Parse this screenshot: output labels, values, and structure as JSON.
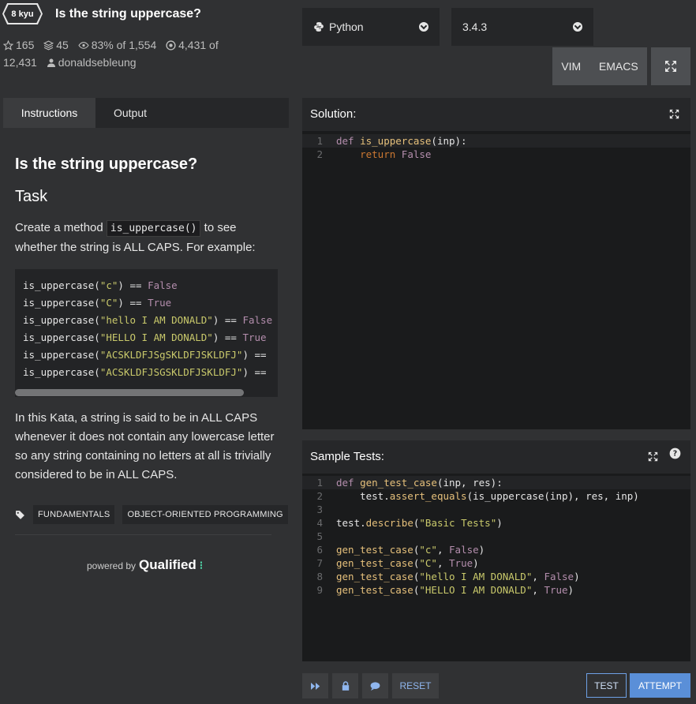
{
  "header": {
    "rank": "8 kyu",
    "title": "Is the string uppercase?",
    "stats": {
      "stars": "165",
      "collections": "45",
      "satisfaction": "83% of 1,554",
      "completed": "4,431 of",
      "total": "12,431",
      "author": "donaldsebleung"
    },
    "language": "Python",
    "version": "3.4.3",
    "mode_vim": "VIM",
    "mode_emacs": "EMACS"
  },
  "tabs": {
    "instructions": "Instructions",
    "output": "Output"
  },
  "instructions": {
    "title": "Is the string uppercase?",
    "task_heading": "Task",
    "intro_before": "Create a method",
    "intro_code": "is_uppercase()",
    "intro_after": "to see whether the string is ALL CAPS. For example:",
    "code_examples": [
      {
        "fn": "is_uppercase(",
        "arg": "\"c\"",
        "rest": ") == ",
        "result": "False"
      },
      {
        "fn": "is_uppercase(",
        "arg": "\"C\"",
        "rest": ") == ",
        "result": "True"
      },
      {
        "fn": "is_uppercase(",
        "arg": "\"hello I AM DONALD\"",
        "rest": ") == ",
        "result": "False"
      },
      {
        "fn": "is_uppercase(",
        "arg": "\"HELLO I AM DONALD\"",
        "rest": ") == ",
        "result": "True"
      },
      {
        "fn": "is_uppercase(",
        "arg": "\"ACSKLDFJSgSKLDFJSKLDFJ\"",
        "rest": ") ==",
        "result": ""
      },
      {
        "fn": "is_uppercase(",
        "arg": "\"ACSKLDFJSGSKLDFJSKLDFJ\"",
        "rest": ") ==",
        "result": ""
      }
    ],
    "explanation": "In this Kata, a string is said to be in ALL CAPS whenever it does not contain any lowercase letter so any string containing no letters at all is trivially considered to be in ALL CAPS.",
    "tags": [
      "FUNDAMENTALS",
      "OBJECT-ORIENTED PROGRAMMING"
    ],
    "powered_by": "powered by",
    "brand": "Qualified"
  },
  "solution": {
    "title": "Solution:",
    "lines": [
      {
        "n": "1",
        "a": "def ",
        "b": "is_uppercase",
        "c": "(inp):"
      },
      {
        "n": "2",
        "a": "    return ",
        "b": "False",
        "c": ""
      }
    ]
  },
  "tests": {
    "title": "Sample Tests:",
    "lines": [
      {
        "n": "1",
        "t": "def gen_test_case(inp, res):"
      },
      {
        "n": "2",
        "t": "    test.assert_equals(is_uppercase(inp), res, inp)"
      },
      {
        "n": "3",
        "t": ""
      },
      {
        "n": "4",
        "t": "test.describe(\"Basic Tests\")"
      },
      {
        "n": "5",
        "t": ""
      },
      {
        "n": "6",
        "t": "gen_test_case(\"c\", False)"
      },
      {
        "n": "7",
        "t": "gen_test_case(\"C\", True)"
      },
      {
        "n": "8",
        "t": "gen_test_case(\"hello I AM DONALD\", False)"
      },
      {
        "n": "9",
        "t": "gen_test_case(\"HELLO I AM DONALD\", True)"
      }
    ]
  },
  "footer": {
    "reset": "RESET",
    "test": "TEST",
    "attempt": "ATTEMPT"
  },
  "colors": {
    "accent": "#5a8fd8",
    "background": "#303133",
    "editor_bg": "#1a1b1c"
  }
}
